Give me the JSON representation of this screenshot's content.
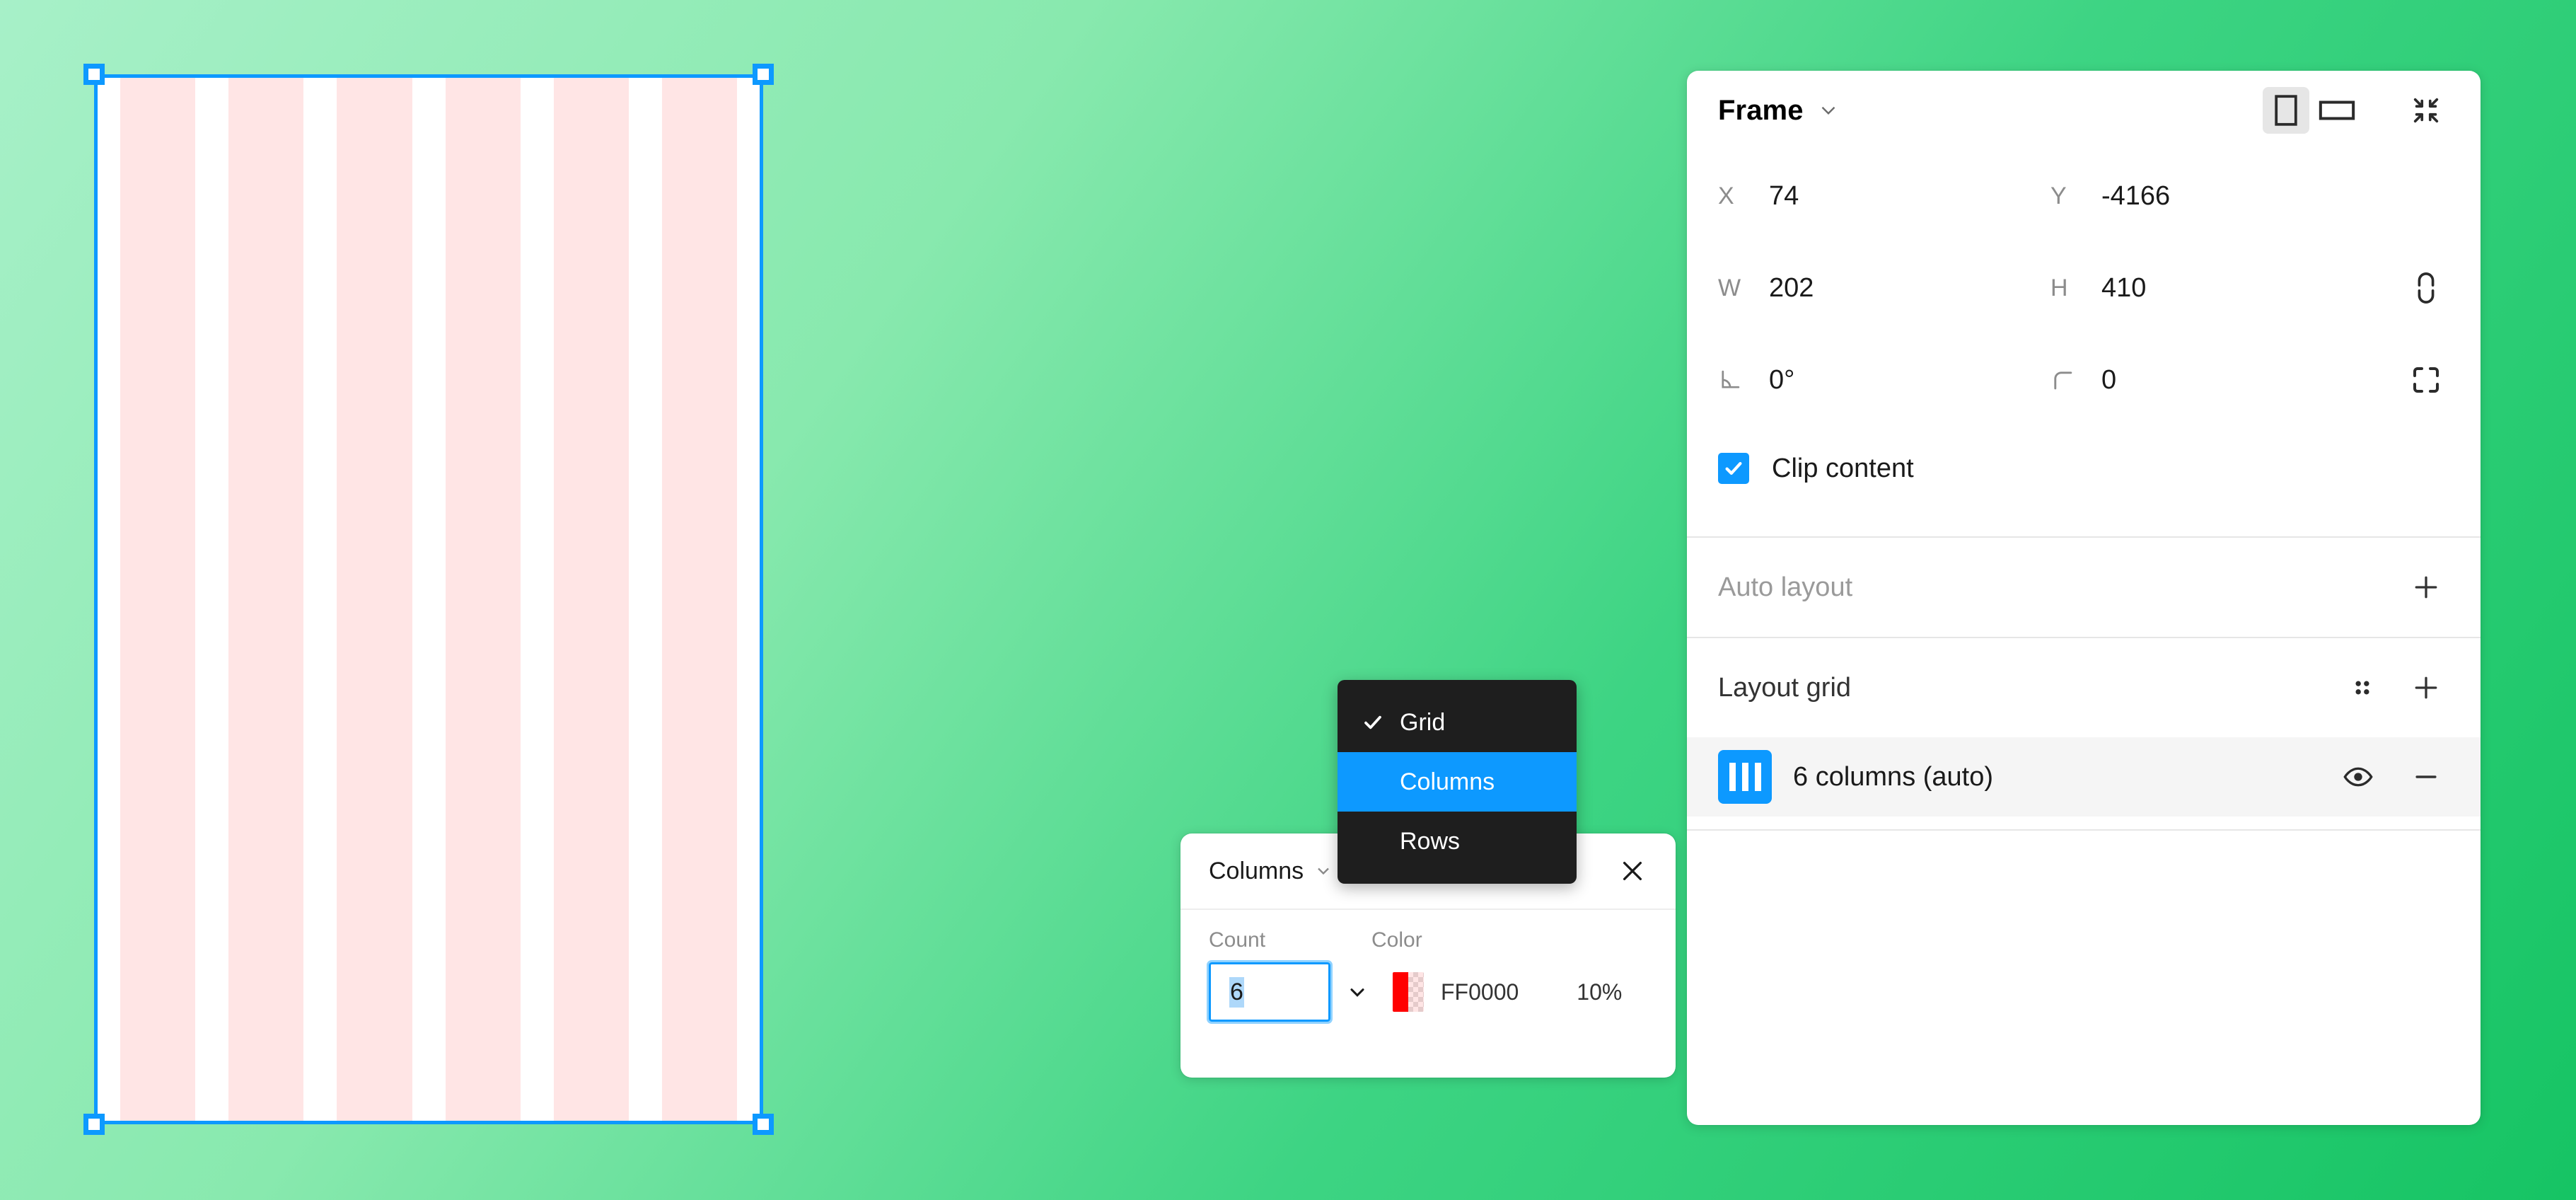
{
  "canvas": {
    "frame": {
      "name": "selected-frame",
      "columns": 6,
      "grid_color": "#FF0000",
      "grid_opacity": "10%"
    },
    "background_gradient": [
      "#A7F0C8",
      "#16C464"
    ]
  },
  "panel": {
    "title": "Frame",
    "orientation": {
      "portrait": "portrait",
      "landscape": "landscape"
    },
    "resize_to_fit": "resize-to-fit",
    "position": {
      "x_label": "X",
      "x_value": "74",
      "y_label": "Y",
      "y_value": "-4166"
    },
    "size": {
      "w_label": "W",
      "w_value": "202",
      "h_label": "H",
      "h_value": "410",
      "proportion_lock": "unlocked"
    },
    "transform": {
      "rotation_label": "rotation",
      "rotation_value": "0°",
      "corner_label": "corner-radius",
      "corner_value": "0",
      "independent_corners": "independent-corners"
    },
    "clip_content": {
      "label": "Clip content",
      "checked": true
    },
    "auto_layout": {
      "label": "Auto layout",
      "add": "+"
    },
    "layout_grid": {
      "label": "Layout grid",
      "settings": "settings",
      "add": "+",
      "items": [
        {
          "label": "6 columns (auto)",
          "visible": true,
          "remove": "−"
        }
      ]
    }
  },
  "grid_popover": {
    "type_label": "Columns",
    "close": "×",
    "count_label": "Count",
    "count_value": "6",
    "color_label": "Color",
    "color_hex": "FF0000",
    "color_opacity": "10%"
  },
  "type_menu": {
    "items": [
      {
        "label": "Grid",
        "checked": true,
        "highlighted": false
      },
      {
        "label": "Columns",
        "checked": false,
        "highlighted": true
      },
      {
        "label": "Rows",
        "checked": false,
        "highlighted": false
      }
    ]
  },
  "colors": {
    "accent_blue": "#0D99FF",
    "grid_red": "#FF0000",
    "menu_dark": "#1E1E1E"
  }
}
